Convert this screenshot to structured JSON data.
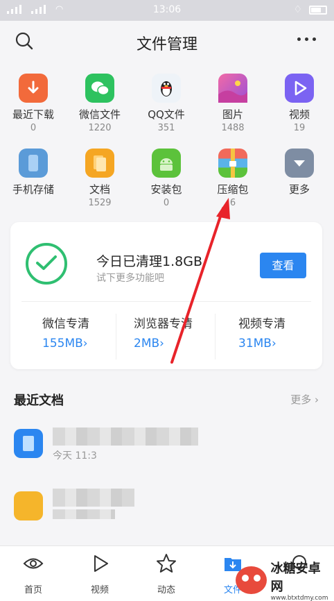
{
  "status_bar": {
    "time": "13:06"
  },
  "header": {
    "title": "文件管理"
  },
  "categories": [
    {
      "label": "最近下载",
      "count": "0",
      "icon": "download-icon",
      "color": "#f26a3b"
    },
    {
      "label": "微信文件",
      "count": "1220",
      "icon": "wechat-icon",
      "color": "#2dc25f"
    },
    {
      "label": "QQ文件",
      "count": "351",
      "icon": "qq-penguin-icon",
      "color": "#eef3f8"
    },
    {
      "label": "图片",
      "count": "1488",
      "icon": "picture-icon",
      "color": "#d64fb6"
    },
    {
      "label": "视频",
      "count": "19",
      "icon": "video-play-icon",
      "color": "#7b63f2"
    },
    {
      "label": "手机存储",
      "count": "",
      "icon": "phone-storage-icon",
      "color": "#5b9bd8"
    },
    {
      "label": "文档",
      "count": "1529",
      "icon": "document-icon",
      "color": "#f5a623"
    },
    {
      "label": "安装包",
      "count": "0",
      "icon": "android-icon",
      "color": "#5cc23b"
    },
    {
      "label": "压缩包",
      "count": "6",
      "icon": "zip-archive-icon",
      "color": "#4fa4e8"
    },
    {
      "label": "更多",
      "count": "",
      "icon": "chevron-down-icon",
      "color": "#7e8da3"
    }
  ],
  "cleaner": {
    "title": "今日已清理1.8GB",
    "subtitle": "试下更多功能吧",
    "button": "查看",
    "items": [
      {
        "name": "微信专清",
        "size": "155MB"
      },
      {
        "name": "浏览器专清",
        "size": "2MB"
      },
      {
        "name": "视频专清",
        "size": "31MB"
      }
    ]
  },
  "recent": {
    "title": "最近文档",
    "more": "更多",
    "docs": [
      {
        "time": "今天 11:3",
        "icon": "doc-file-icon",
        "color": "#2b86f0"
      },
      {
        "time": "",
        "icon": "folder-file-icon",
        "color": "#f5b52b"
      }
    ]
  },
  "tabs": [
    {
      "label": "首页",
      "icon": "eye-icon"
    },
    {
      "label": "视频",
      "icon": "play-icon"
    },
    {
      "label": "动态",
      "icon": "star-icon"
    },
    {
      "label": "文件",
      "icon": "file-download-icon"
    },
    {
      "label": "",
      "icon": "chat-icon"
    }
  ],
  "watermark": {
    "title": "冰糖安卓网",
    "url": "www.btxtdmy.com"
  }
}
